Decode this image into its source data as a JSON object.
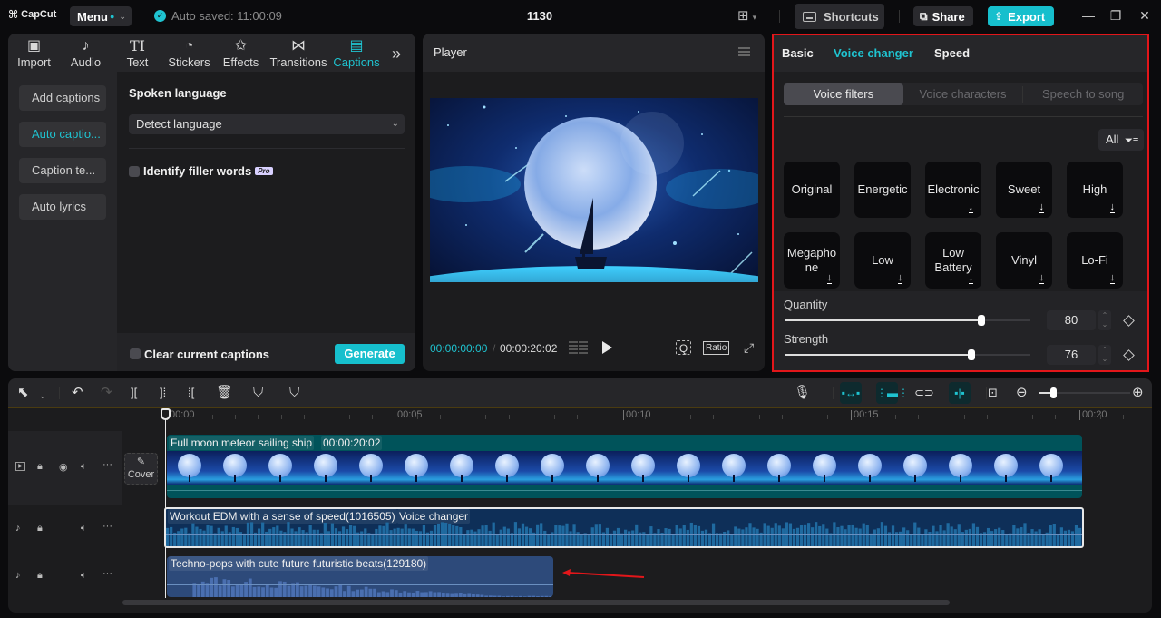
{
  "app": {
    "logo": "CapCut",
    "menu_label": "Menu",
    "autosave_text": "Auto saved: 11:00:09",
    "project_title": "1130",
    "shortcuts_label": "Shortcuts",
    "share_label": "Share",
    "export_label": "Export",
    "accent_color": "#1fc3d0",
    "highlight_color": "#e2161a"
  },
  "media_tabs": [
    {
      "label": "Import",
      "icon": "import-icon",
      "glyph": "▣"
    },
    {
      "label": "Audio",
      "icon": "audio-icon",
      "glyph": "♪"
    },
    {
      "label": "Text",
      "icon": "text-icon",
      "glyph": "TI"
    },
    {
      "label": "Stickers",
      "icon": "sticker-icon",
      "glyph": "◔"
    },
    {
      "label": "Effects",
      "icon": "effects-icon",
      "glyph": "✩"
    },
    {
      "label": "Transitions",
      "icon": "transitions-icon",
      "glyph": "⋈"
    },
    {
      "label": "Captions",
      "icon": "captions-icon",
      "glyph": "▤",
      "active": true
    }
  ],
  "more_tabs_glyph": "»",
  "captions": {
    "side_nav": [
      "Add captions",
      "Auto captio...",
      "Caption te...",
      "Auto lyrics"
    ],
    "active_index": 1,
    "spoken_language_label": "Spoken language",
    "language_value": "Detect language",
    "identify_filler_label": "Identify filler words",
    "pro_badge": "Pro",
    "clear_captions_label": "Clear current captions",
    "generate_label": "Generate"
  },
  "player": {
    "title": "Player",
    "current_time": "00:00:00:00",
    "separator": "/",
    "total_time": "00:00:20:02",
    "ratio_label": "Ratio"
  },
  "right_panel": {
    "tabs": [
      "Basic",
      "Voice changer",
      "Speed"
    ],
    "active_tab": "Voice changer",
    "segments": [
      "Voice filters",
      "Voice characters",
      "Speech to song"
    ],
    "active_segment": "Voice filters",
    "filter_label": "All",
    "filters": [
      {
        "name": "Original",
        "download": false
      },
      {
        "name": "Energetic",
        "download": false
      },
      {
        "name": "Electronic",
        "download": true
      },
      {
        "name": "Sweet",
        "download": true
      },
      {
        "name": "High",
        "download": true
      },
      {
        "name": "Megapho ne",
        "download": true
      },
      {
        "name": "Low",
        "download": true
      },
      {
        "name": "Low Battery",
        "download": true
      },
      {
        "name": "Vinyl",
        "download": true
      },
      {
        "name": "Lo-Fi",
        "download": true
      }
    ],
    "params": [
      {
        "label": "Quantity",
        "value": 80,
        "max": 100
      },
      {
        "label": "Strength",
        "value": 76,
        "max": 100
      }
    ]
  },
  "timeline": {
    "ruler_labels": [
      "00:00",
      "00:05",
      "00:10",
      "00:15",
      "00:20"
    ],
    "zoom_level": 0.12,
    "cover_label": "Cover",
    "tracks": {
      "video": {
        "title": "Full moon meteor sailing ship",
        "duration": "00:00:20:02"
      },
      "audio1": {
        "title": "Workout EDM with a sense of speed(1016505)",
        "tag": "Voice changer"
      },
      "audio2": {
        "title": "Techno-pops with cute future futuristic beats(129180)"
      }
    }
  }
}
